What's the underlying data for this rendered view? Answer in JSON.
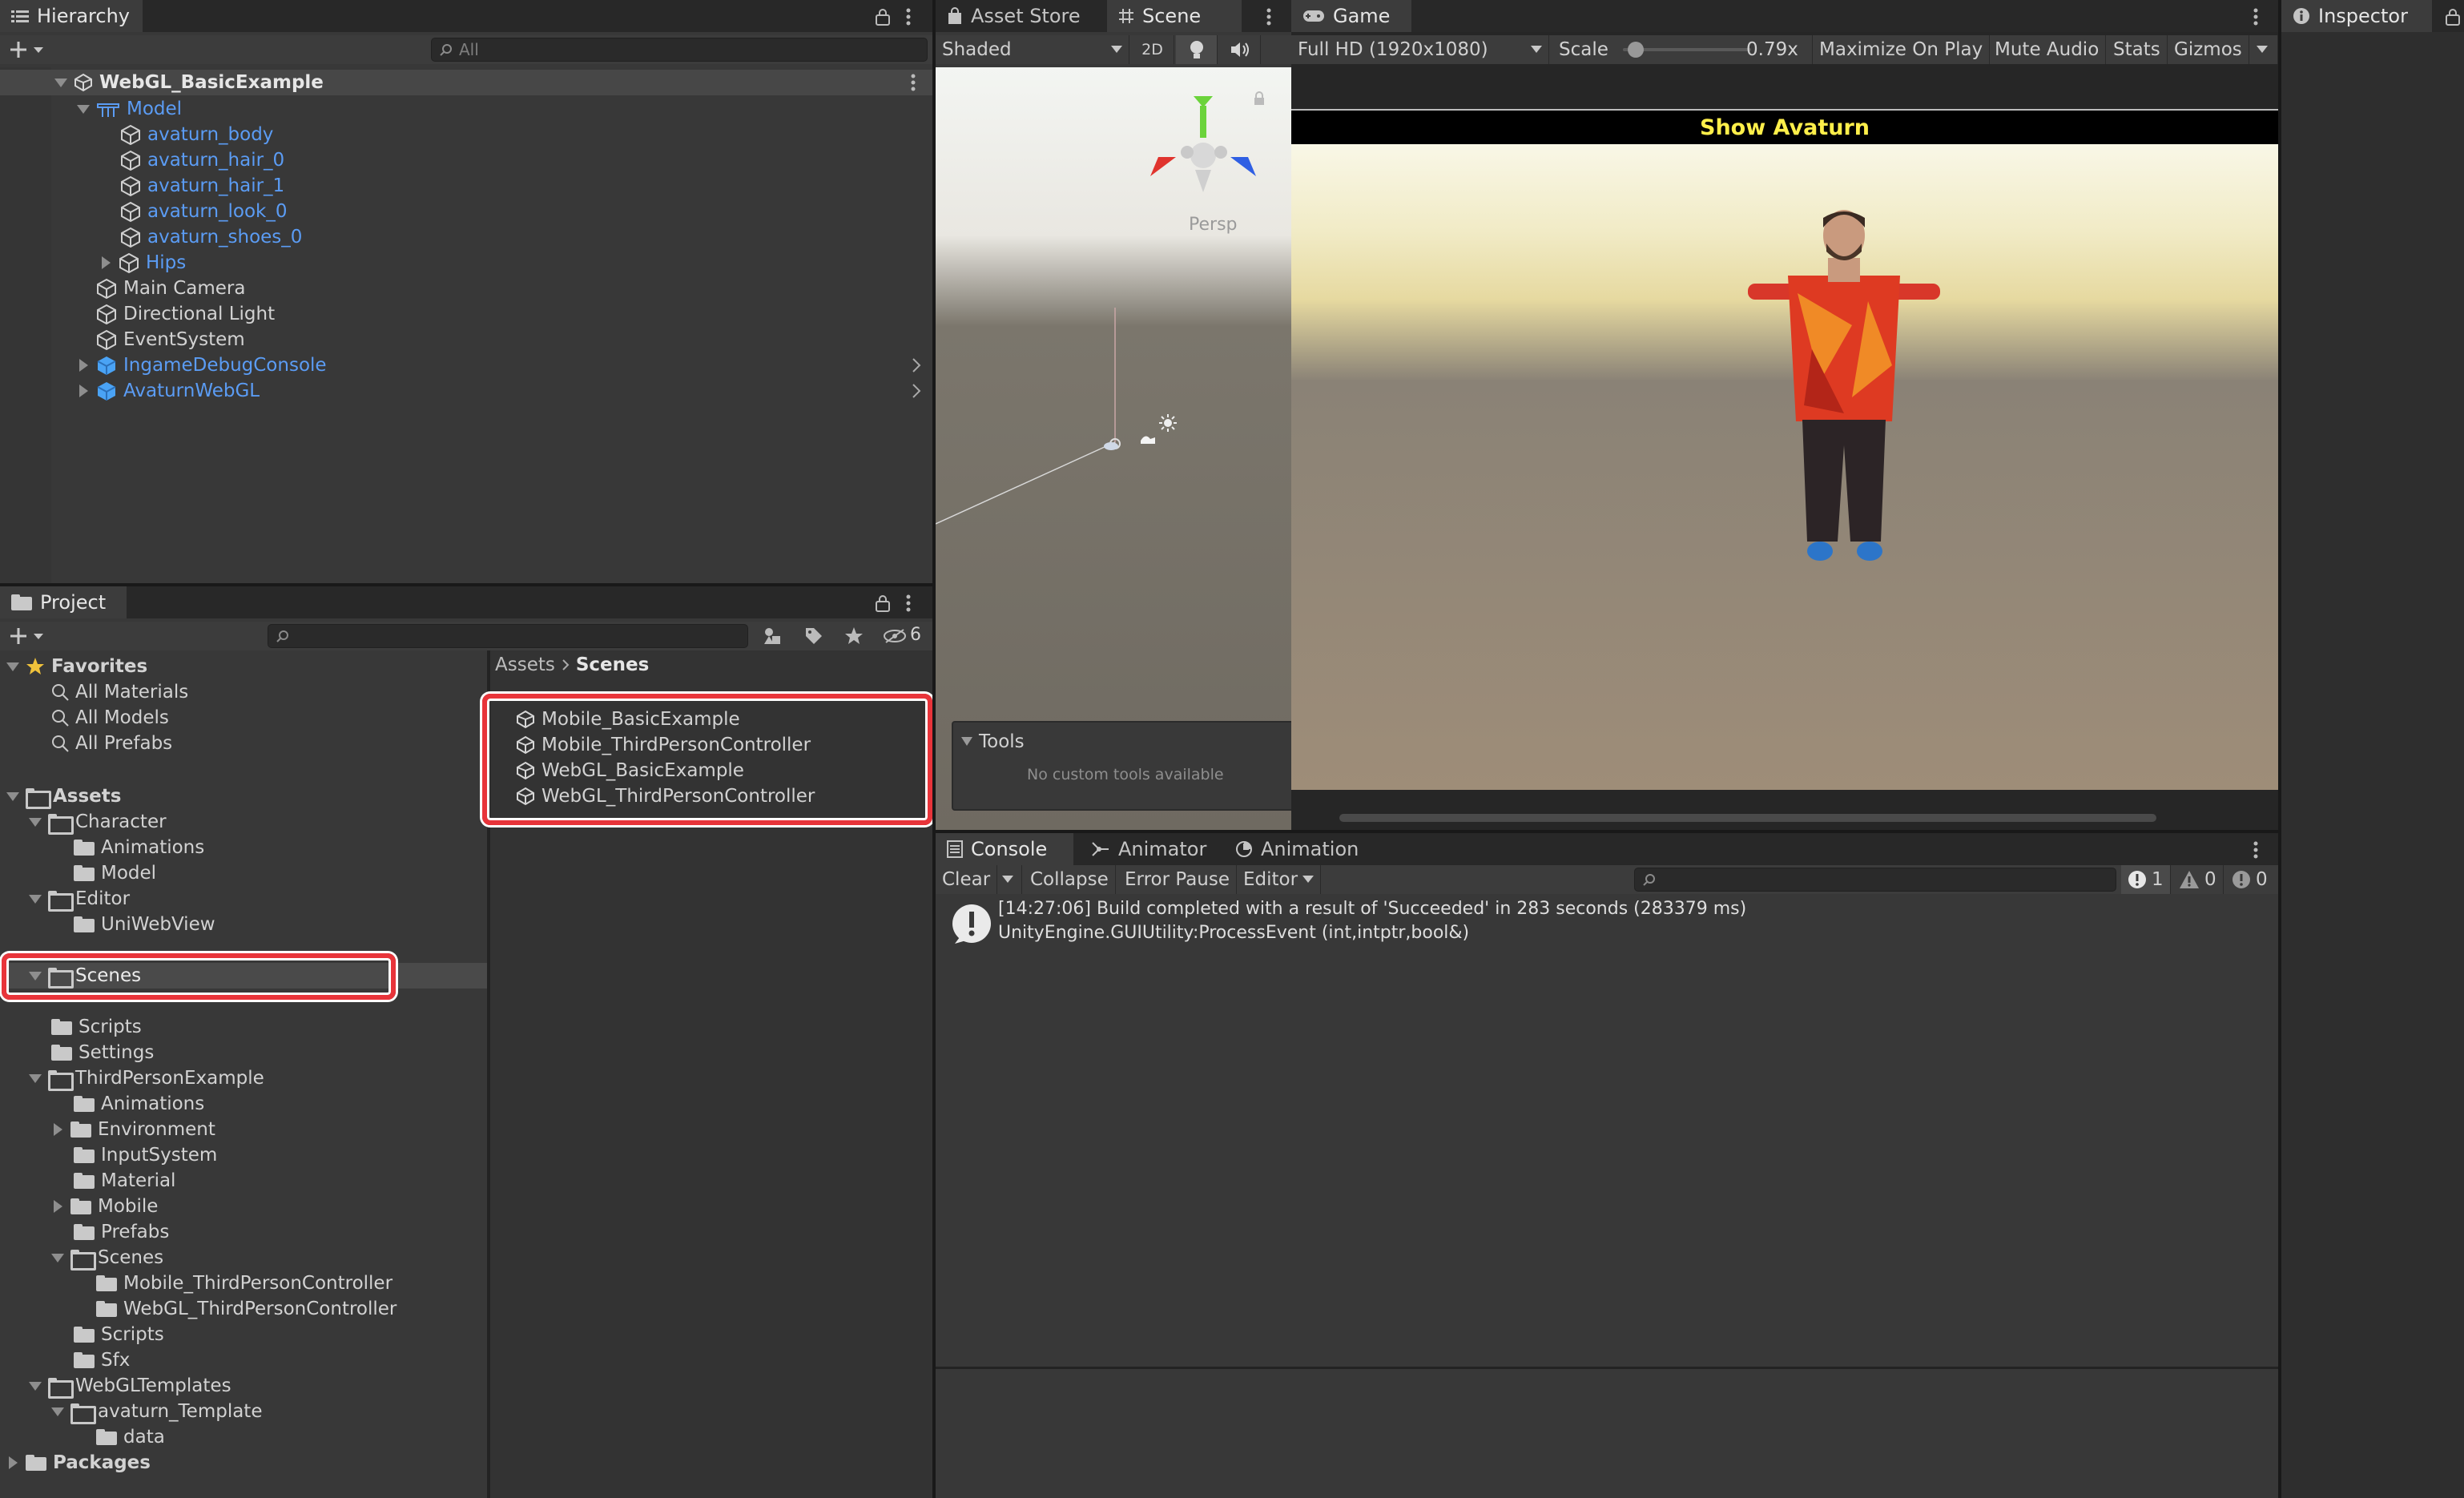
{
  "hierarchy": {
    "tab": "Hierarchy",
    "search_placeholder": "All",
    "scene_root": "WebGL_BasicExample",
    "items": [
      {
        "label": "Model"
      },
      {
        "label": "avaturn_body"
      },
      {
        "label": "avaturn_hair_0"
      },
      {
        "label": "avaturn_hair_1"
      },
      {
        "label": "avaturn_look_0"
      },
      {
        "label": "avaturn_shoes_0"
      },
      {
        "label": "Hips"
      },
      {
        "label": "Main Camera"
      },
      {
        "label": "Directional Light"
      },
      {
        "label": "EventSystem"
      },
      {
        "label": "IngameDebugConsole"
      },
      {
        "label": "AvaturnWebGL"
      }
    ]
  },
  "project": {
    "tab": "Project",
    "filter_count": "6",
    "favorites": {
      "label": "Favorites",
      "items": [
        "All Materials",
        "All Models",
        "All Prefabs"
      ]
    },
    "tree": [
      "Assets",
      "Character",
      "Animations",
      "Model",
      "Editor",
      "UniWebView",
      "Scenes",
      "Scripts",
      "Settings",
      "ThirdPersonExample",
      "Animations",
      "Environment",
      "InputSystem",
      "Material",
      "Mobile",
      "Prefabs",
      "Scenes",
      "Mobile_ThirdPersonController",
      "WebGL_ThirdPersonController",
      "Scripts",
      "Sfx",
      "WebGLTemplates",
      "avaturn_Template",
      "data",
      "Packages"
    ],
    "breadcrumb": {
      "root": "Assets",
      "current": "Scenes"
    },
    "files": [
      "Mobile_BasicExample",
      "Mobile_ThirdPersonController",
      "WebGL_BasicExample",
      "WebGL_ThirdPersonController"
    ]
  },
  "scene": {
    "tabs": {
      "asset_store": "Asset Store",
      "scene": "Scene"
    },
    "shading": "Shaded",
    "mode_2d": "2D",
    "persp": "Persp",
    "tools_title": "Tools",
    "tools_empty": "No custom tools available"
  },
  "game": {
    "tab": "Game",
    "resolution": "Full HD (1920x1080)",
    "scale_label": "Scale",
    "scale_value": "0.79x",
    "maximize": "Maximize On Play",
    "mute": "Mute Audio",
    "stats": "Stats",
    "gizmos": "Gizmos",
    "banner": "Show Avaturn"
  },
  "inspector": {
    "tab": "Inspector"
  },
  "console": {
    "tabs": {
      "console": "Console",
      "animator": "Animator",
      "animation": "Animation"
    },
    "clear": "Clear",
    "collapse": "Collapse",
    "error_pause": "Error Pause",
    "editor": "Editor",
    "counts": {
      "info": "1",
      "warn": "0",
      "error": "0"
    },
    "log_line1": "[14:27:06] Build completed with a result of 'Succeeded' in 283 seconds (283379 ms)",
    "log_line2": "UnityEngine.GUIUtility:ProcessEvent (int,intptr,bool&)"
  },
  "colors": {
    "highlight": "#e8343a",
    "prefab_blue": "#5b9cf4",
    "banner_text": "#ffef4a"
  }
}
